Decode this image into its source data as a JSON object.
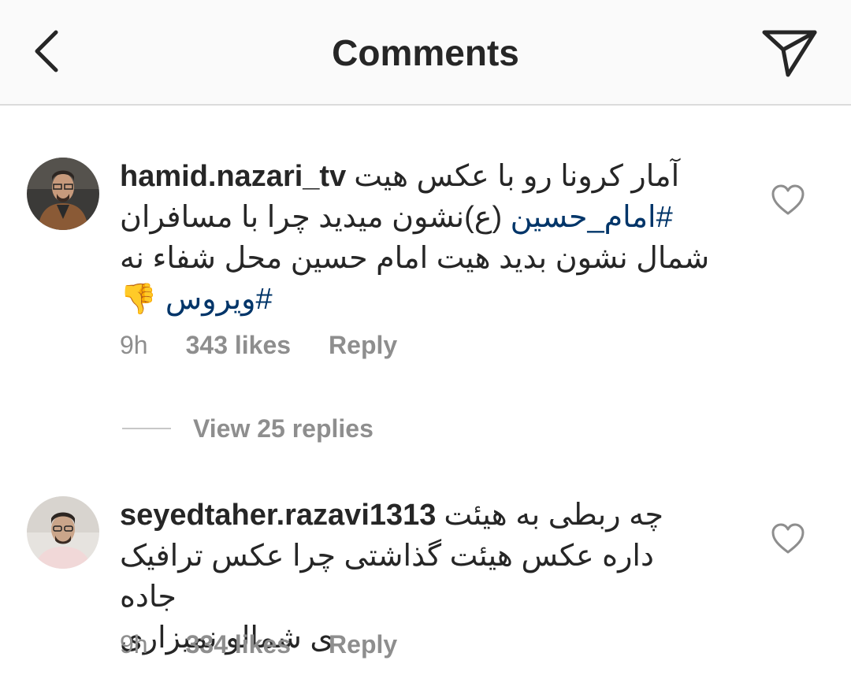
{
  "header": {
    "title": "Comments",
    "back_icon": "chevron-left-icon",
    "send_icon": "paper-plane-icon"
  },
  "comments": [
    {
      "username": "hamid.nazari_tv",
      "line1": "آمار کرونا رو با عکس هیت",
      "line2_hashtag": "#امام_حسین",
      "line2_rest": " (ع)نشون میدید چرا با مسافران",
      "line3": "شمال نشون بدید هیت امام حسین محل شفاء نه",
      "line4_hashtag": "#ویروس",
      "line4_emoji": "👎",
      "time": "9h",
      "likes": "343 likes",
      "reply": "Reply"
    },
    {
      "username": "seyedtaher.razavi1313",
      "line1": "چه ربطی به هیئت",
      "line2": "داره عکس هیئت گذاشتی چرا عکس ترافیک جاده",
      "line3": "ی شمالو نمیزاری",
      "time": "9h",
      "likes": "334 likes",
      "reply": "Reply"
    }
  ],
  "view_replies": "View 25 replies",
  "colors": {
    "hashtag": "#003569",
    "meta": "#8e8e8e",
    "text": "#262626",
    "header_bg": "#fafafa"
  }
}
